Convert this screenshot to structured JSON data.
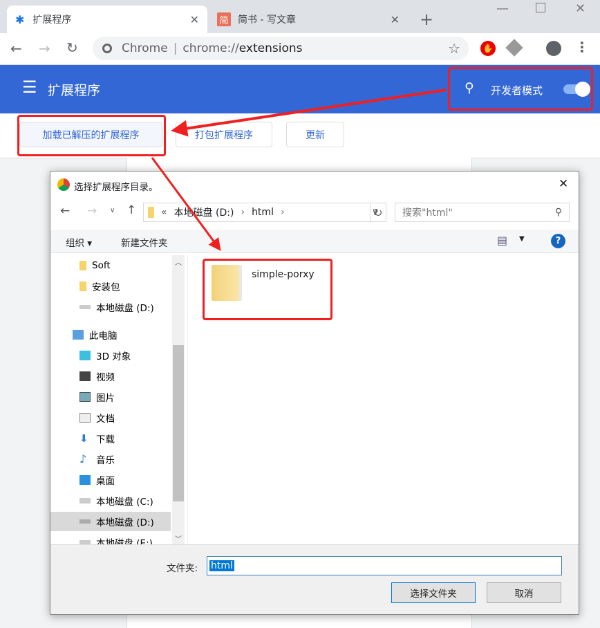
{
  "browser": {
    "tabs": [
      {
        "title": "扩展程序",
        "icon": "puzzle-icon"
      },
      {
        "title": "简书 - 写文章",
        "icon": "jianshu-icon",
        "icon_text": "简"
      }
    ],
    "omnibox": {
      "scheme_label": "Chrome",
      "url_prefix": "chrome://",
      "url_path": "extensions"
    }
  },
  "extensions_page": {
    "title": "扩展程序",
    "developer_mode_label": "开发者模式",
    "developer_mode_on": true,
    "buttons": {
      "load_unpacked": "加载已解压的扩展程序",
      "pack": "打包扩展程序",
      "update": "更新"
    }
  },
  "dialog": {
    "title": "选择扩展程序目录。",
    "breadcrumb": {
      "overflow": "«",
      "items": [
        "本地磁盘 (D:)",
        "html"
      ]
    },
    "search_placeholder": "搜索\"html\"",
    "toolbar": {
      "organize": "组织",
      "new_folder": "新建文件夹"
    },
    "nav": [
      {
        "label": "Soft",
        "icon": "folder-icon"
      },
      {
        "label": "安装包",
        "icon": "folder-icon"
      },
      {
        "label": "本地磁盘 (D:)",
        "icon": "drive-icon"
      },
      {
        "label": "此电脑",
        "icon": "computer-icon"
      },
      {
        "label": "3D 对象",
        "icon": "3d-objects-icon"
      },
      {
        "label": "视频",
        "icon": "video-icon"
      },
      {
        "label": "图片",
        "icon": "pictures-icon"
      },
      {
        "label": "文档",
        "icon": "documents-icon"
      },
      {
        "label": "下载",
        "icon": "download-icon"
      },
      {
        "label": "音乐",
        "icon": "music-icon"
      },
      {
        "label": "桌面",
        "icon": "desktop-icon"
      },
      {
        "label": "本地磁盘 (C:)",
        "icon": "drive-icon"
      },
      {
        "label": "本地磁盘 (D:)",
        "icon": "drive-icon",
        "selected": true
      },
      {
        "label": "本地磁盘 (E:)",
        "icon": "drive-icon"
      }
    ],
    "files": [
      {
        "name": "simple-porxy",
        "type": "folder"
      }
    ],
    "folder_label": "文件夹:",
    "folder_value": "html",
    "select_button": "选择文件夹",
    "cancel_button": "取消"
  },
  "colors": {
    "header": "#3367d6",
    "annotation": "#f02020"
  }
}
